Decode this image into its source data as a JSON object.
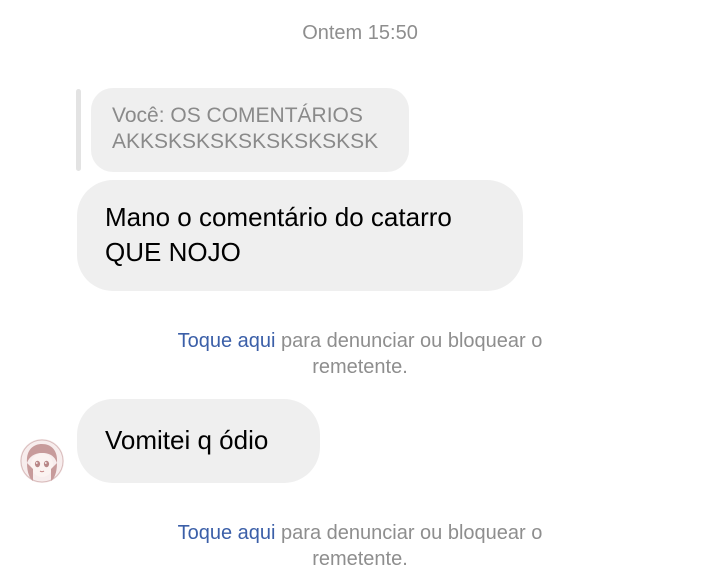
{
  "thread": {
    "timestamp": "Ontem 15:50",
    "reply_quote": "Você: OS COMENTÁRIOS\nAKKSKSKSKSKSKSKSKSK",
    "messages": [
      {
        "text": "Mano o comentário do catarro\nQUE NOJO"
      },
      {
        "text": "Vomitei q ódio"
      }
    ],
    "notice": {
      "link": "Toque aqui",
      "rest_line1": " para denunciar ou bloquear o",
      "line2": "remetente."
    }
  },
  "avatar": {
    "icon": "contact-avatar-icon"
  }
}
